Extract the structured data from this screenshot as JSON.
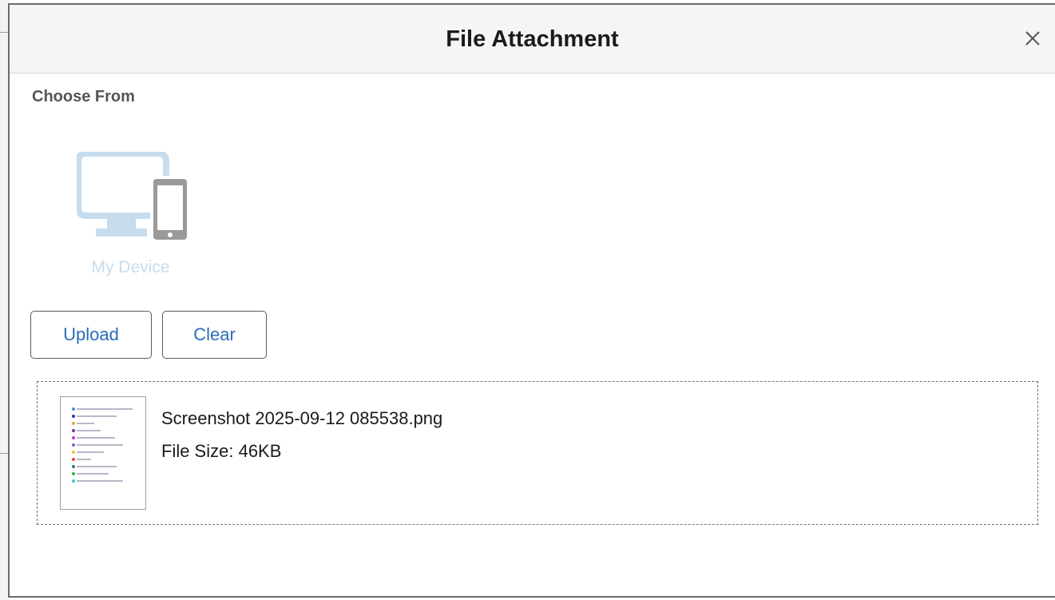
{
  "dialog": {
    "title": "File Attachment",
    "close_label": "×"
  },
  "choose_from": {
    "label": "Choose From",
    "sources": [
      {
        "label": "My Device",
        "icon": "device-icon"
      }
    ]
  },
  "actions": {
    "upload_label": "Upload",
    "clear_label": "Clear"
  },
  "attachment": {
    "file_name": "Screenshot 2025-09-12 085538.png",
    "file_size": "File Size: 46KB",
    "thumbnail_icon": "image-thumbnail-icon"
  },
  "colors": {
    "accent": "#2a6db7",
    "device_icon_light": "#c6dcef",
    "device_icon_gray": "#9a9a9a",
    "header_bg": "#f6f5f3"
  }
}
